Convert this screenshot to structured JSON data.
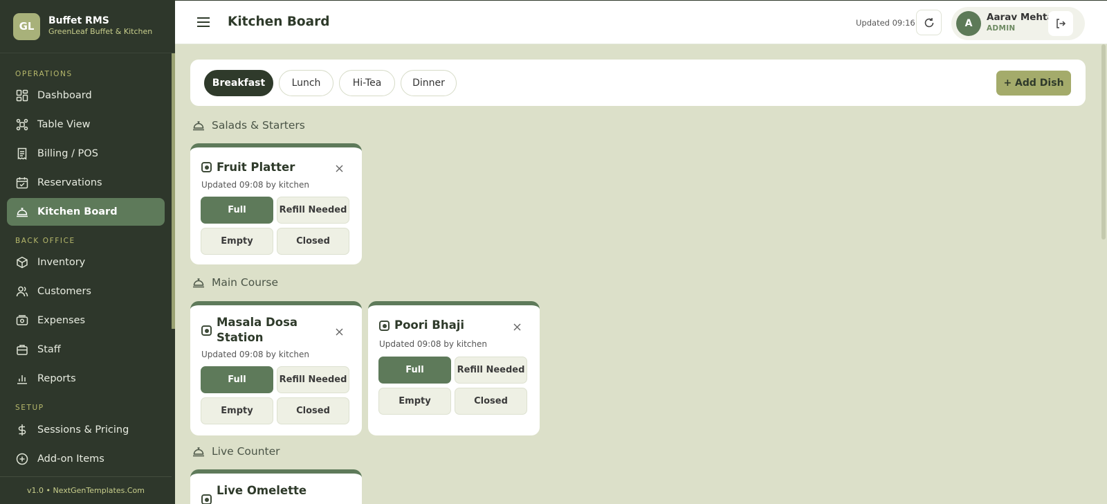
{
  "brand": {
    "initials": "GL",
    "name": "Buffet RMS",
    "subtitle": "GreenLeaf Buffet & Kitchen"
  },
  "sidebar": {
    "sections": [
      {
        "label": "OPERATIONS"
      },
      {
        "label": "BACK OFFICE"
      },
      {
        "label": "SETUP"
      }
    ],
    "items": [
      {
        "label": "Dashboard",
        "icon": "dashboard-icon"
      },
      {
        "label": "Table View",
        "icon": "table-view-icon"
      },
      {
        "label": "Billing / POS",
        "icon": "receipt-icon"
      },
      {
        "label": "Reservations",
        "icon": "calendar-check-icon"
      },
      {
        "label": "Kitchen Board",
        "icon": "cloche-icon",
        "active": true
      },
      {
        "label": "Inventory",
        "icon": "box-icon"
      },
      {
        "label": "Customers",
        "icon": "users-icon"
      },
      {
        "label": "Expenses",
        "icon": "wallet-icon"
      },
      {
        "label": "Staff",
        "icon": "briefcase-icon"
      },
      {
        "label": "Reports",
        "icon": "bar-chart-icon"
      },
      {
        "label": "Sessions & Pricing",
        "icon": "dollar-icon"
      },
      {
        "label": "Add-on Items",
        "icon": "plus-circle-icon"
      }
    ],
    "footer": "v1.0 • NextGenTemplates.Com"
  },
  "header": {
    "title": "Kitchen Board",
    "updated": "Updated 09:16",
    "user": {
      "initial": "A",
      "name": "Aarav Mehta",
      "role": "ADMIN"
    }
  },
  "sessions": {
    "tabs": [
      {
        "label": "Breakfast",
        "active": true
      },
      {
        "label": "Lunch"
      },
      {
        "label": "Hi-Tea"
      },
      {
        "label": "Dinner"
      }
    ],
    "add_label": "+ Add Dish"
  },
  "categories": [
    {
      "name": "Salads & Starters",
      "dishes": [
        {
          "name": "Fruit Platter",
          "updated": "Updated 09:08 by kitchen",
          "status": "Full"
        }
      ]
    },
    {
      "name": "Main Course",
      "dishes": [
        {
          "name": "Masala Dosa Station",
          "updated": "Updated 09:08 by kitchen",
          "status": "Full"
        },
        {
          "name": "Poori Bhaji",
          "updated": "Updated 09:08 by kitchen",
          "status": "Full"
        }
      ]
    },
    {
      "name": "Live Counter",
      "dishes": [
        {
          "name": "Live Omelette"
        }
      ]
    }
  ],
  "status_options": [
    "Full",
    "Refill Needed",
    "Empty",
    "Closed"
  ],
  "colors": {
    "sidebar": "#2e372b",
    "accent": "#5e7a5a",
    "active_pill": "#2f3a2b",
    "add_button": "#a4ab6b",
    "background": "#dce0c9"
  }
}
